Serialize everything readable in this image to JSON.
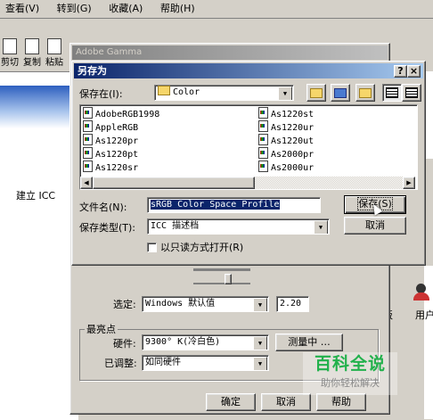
{
  "menubar": {
    "items": [
      "查看(V)",
      "转到(G)",
      "收藏(A)",
      "帮助(H)"
    ]
  },
  "toolbar": {
    "items": [
      "剪切",
      "复制",
      "粘贴"
    ]
  },
  "background": {
    "left_text": "建立 ICC",
    "right_texts": [
      "板",
      "用户"
    ]
  },
  "gamma_window": {
    "title": "Adobe Gamma",
    "selected_label": "选定:",
    "selected_value": "Windows 默认值",
    "gamma_value": "2.20",
    "brightest_group": "最亮点",
    "hardware_label": "硬件:",
    "hardware_value": "9300° K(冷白色)",
    "measure_button": "测量中",
    "adjusted_label": "已调整:",
    "adjusted_value": "如同硬件",
    "ok_button": "确定",
    "cancel_button": "取消",
    "help_button": "帮助"
  },
  "save_dialog": {
    "title": "另存为",
    "help_btn": "?",
    "close_btn": "×",
    "save_in_label": "保存在(I):",
    "save_in_value": "Color",
    "files": [
      "AdobeRGB1998",
      "AppleRGB",
      "As1220pr",
      "As1220pt",
      "As1220sr",
      "As1220st",
      "As1220ur",
      "As1220ut",
      "As2000pr",
      "As2000ur"
    ],
    "filename_label": "文件名(N):",
    "filename_value": "sRGB Color Space Profile",
    "save_button": "保存(S)",
    "filetype_label": "保存类型(T):",
    "filetype_value": "ICC 描述档",
    "cancel_button": "取消",
    "readonly_label": "以只读方式打开(R)"
  },
  "watermark": {
    "title": "百科全说",
    "subtitle": "助你轻松解决"
  }
}
